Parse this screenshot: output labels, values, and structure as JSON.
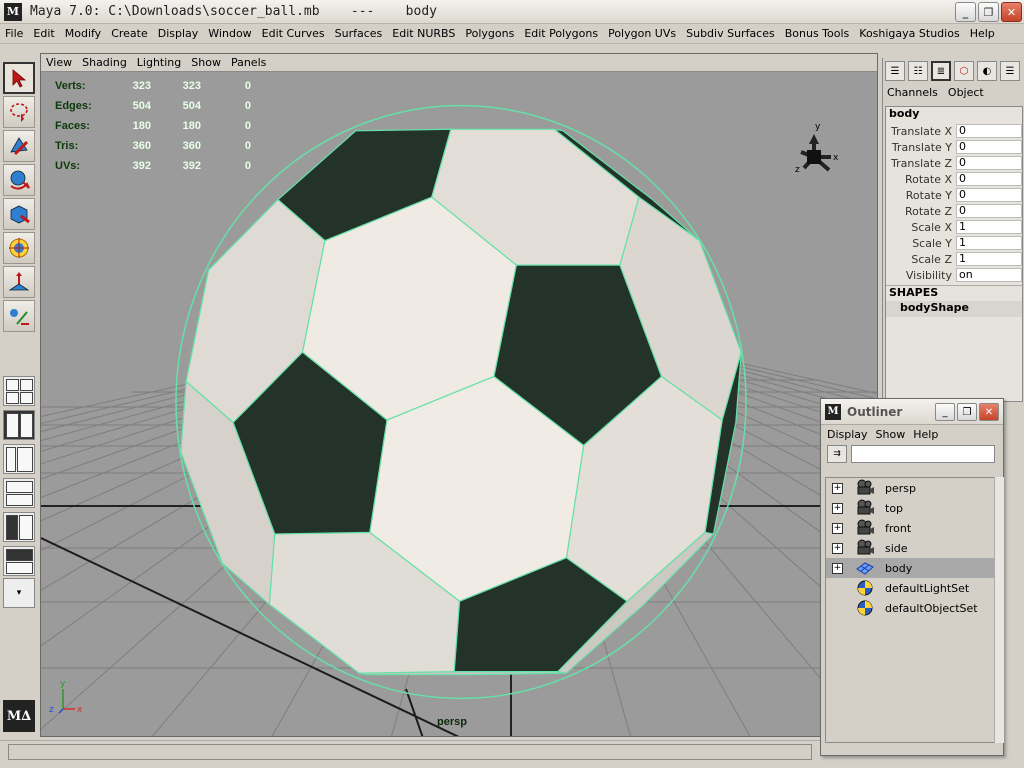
{
  "window": {
    "title": "Maya 7.0: C:\\Downloads\\soccer_ball.mb    ---    body",
    "logo": "M",
    "minimize_glyph": "_",
    "maximize_glyph": "❐",
    "close_glyph": "✕"
  },
  "menu": [
    "File",
    "Edit",
    "Modify",
    "Create",
    "Display",
    "Window",
    "Edit Curves",
    "Surfaces",
    "Edit NURBS",
    "Polygons",
    "Edit Polygons",
    "Polygon UVs",
    "Subdiv Surfaces",
    "Bonus Tools",
    "Koshigaya Studios",
    "Help"
  ],
  "toolbox": {
    "tools": [
      "select-tool-icon",
      "lasso-tool-icon",
      "paint-select-icon",
      "move-tool-icon",
      "rotate-tool-icon",
      "scale-tool-icon",
      "manipulator-tool-icon",
      "last-tool-icon"
    ],
    "expand_glyph": "▾",
    "logo": "M∆"
  },
  "viewport": {
    "menu": [
      "View",
      "Shading",
      "Lighting",
      "Show",
      "Panels"
    ],
    "hud": [
      {
        "label": "Verts:",
        "a": "323",
        "b": "323",
        "c": "0"
      },
      {
        "label": "Edges:",
        "a": "504",
        "b": "504",
        "c": "0"
      },
      {
        "label": "Faces:",
        "a": "180",
        "b": "180",
        "c": "0"
      },
      {
        "label": "Tris:",
        "a": "360",
        "b": "360",
        "c": "0"
      },
      {
        "label": "UVs:",
        "a": "392",
        "b": "392",
        "c": "0"
      }
    ],
    "camera": "persp",
    "axis_labels": {
      "x": "x",
      "y": "y",
      "z": "z"
    },
    "colors": {
      "background": "#9b9b9b",
      "wire": "#66e0a8",
      "patch": "#243329",
      "panel": "#f6f1ea"
    }
  },
  "channel_box": {
    "tabs": [
      "Channels",
      "Object"
    ],
    "object": "body",
    "attributes": [
      {
        "name": "Translate X",
        "value": "0"
      },
      {
        "name": "Translate Y",
        "value": "0"
      },
      {
        "name": "Translate Z",
        "value": "0"
      },
      {
        "name": "Rotate X",
        "value": "0"
      },
      {
        "name": "Rotate Y",
        "value": "0"
      },
      {
        "name": "Rotate Z",
        "value": "0"
      },
      {
        "name": "Scale X",
        "value": "1"
      },
      {
        "name": "Scale Y",
        "value": "1"
      },
      {
        "name": "Scale Z",
        "value": "1"
      },
      {
        "name": "Visibility",
        "value": "on"
      }
    ],
    "shapes_title": "SHAPES",
    "shape": "bodyShape"
  },
  "outliner": {
    "title": "Outliner",
    "logo": "M",
    "menu": [
      "Display",
      "Show",
      "Help"
    ],
    "items": [
      {
        "label": "persp",
        "icon": "camera-icon",
        "expandable": true,
        "selected": false
      },
      {
        "label": "top",
        "icon": "camera-icon",
        "expandable": true,
        "selected": false
      },
      {
        "label": "front",
        "icon": "camera-icon",
        "expandable": true,
        "selected": false
      },
      {
        "label": "side",
        "icon": "camera-icon",
        "expandable": true,
        "selected": false
      },
      {
        "label": "body",
        "icon": "mesh-icon",
        "expandable": true,
        "selected": true
      },
      {
        "label": "defaultLightSet",
        "icon": "set-icon",
        "expandable": false,
        "selected": false
      },
      {
        "label": "defaultObjectSet",
        "icon": "set-icon",
        "expandable": false,
        "selected": false
      }
    ],
    "expand_glyph": "+"
  }
}
